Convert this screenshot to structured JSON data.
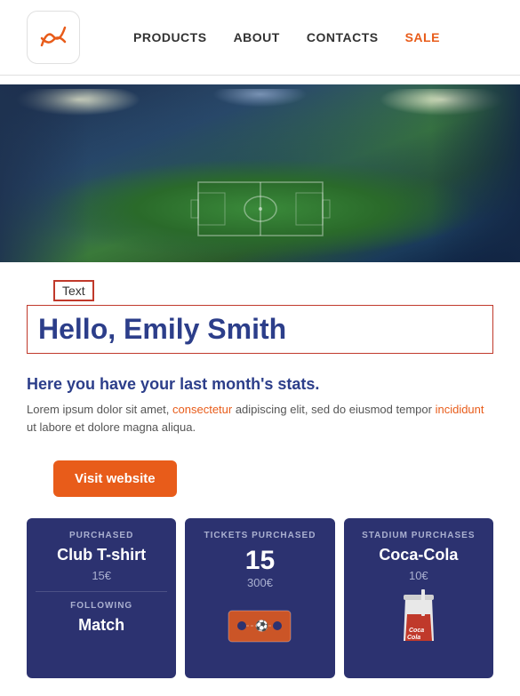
{
  "header": {
    "logo_alt": "Brand Logo",
    "nav_items": [
      {
        "label": "PRODUCTS",
        "class": "normal"
      },
      {
        "label": "ABOUT",
        "class": "normal"
      },
      {
        "label": "CONTACTS",
        "class": "normal"
      },
      {
        "label": "SALE",
        "class": "sale"
      }
    ]
  },
  "hero": {
    "alt": "Football stadium aerial view"
  },
  "text_badge": {
    "label": "Text"
  },
  "greeting": {
    "prefix": "Hello, ",
    "name": "Emily Smith",
    "full": "Hello, Emily Smith"
  },
  "stats": {
    "title": "Here you have your last month's stats.",
    "description_part1": "Lorem ipsum dolor sit amet, consectetur adipiscing elit, sed do eiusmod tempor incididunt ut labore et dolore magna aliqua.",
    "consectetur_link": "consectetur",
    "incididunt_link": "incididunt"
  },
  "cta_button": {
    "label": "Visit website"
  },
  "cards": [
    {
      "type": "purchased",
      "label": "PURCHASED",
      "title": "Club T-shirt",
      "price": "15€",
      "following_label": "FOLLOWING",
      "following_title": "Match"
    },
    {
      "type": "tickets",
      "label": "TICKETS PURCHASED",
      "big_number": "15",
      "sub_price": "300€",
      "icon_type": "ticket"
    },
    {
      "type": "stadium",
      "label": "STADIUM PURCHASES",
      "title": "Coca-Cola",
      "price": "10€",
      "icon_type": "cola"
    }
  ]
}
